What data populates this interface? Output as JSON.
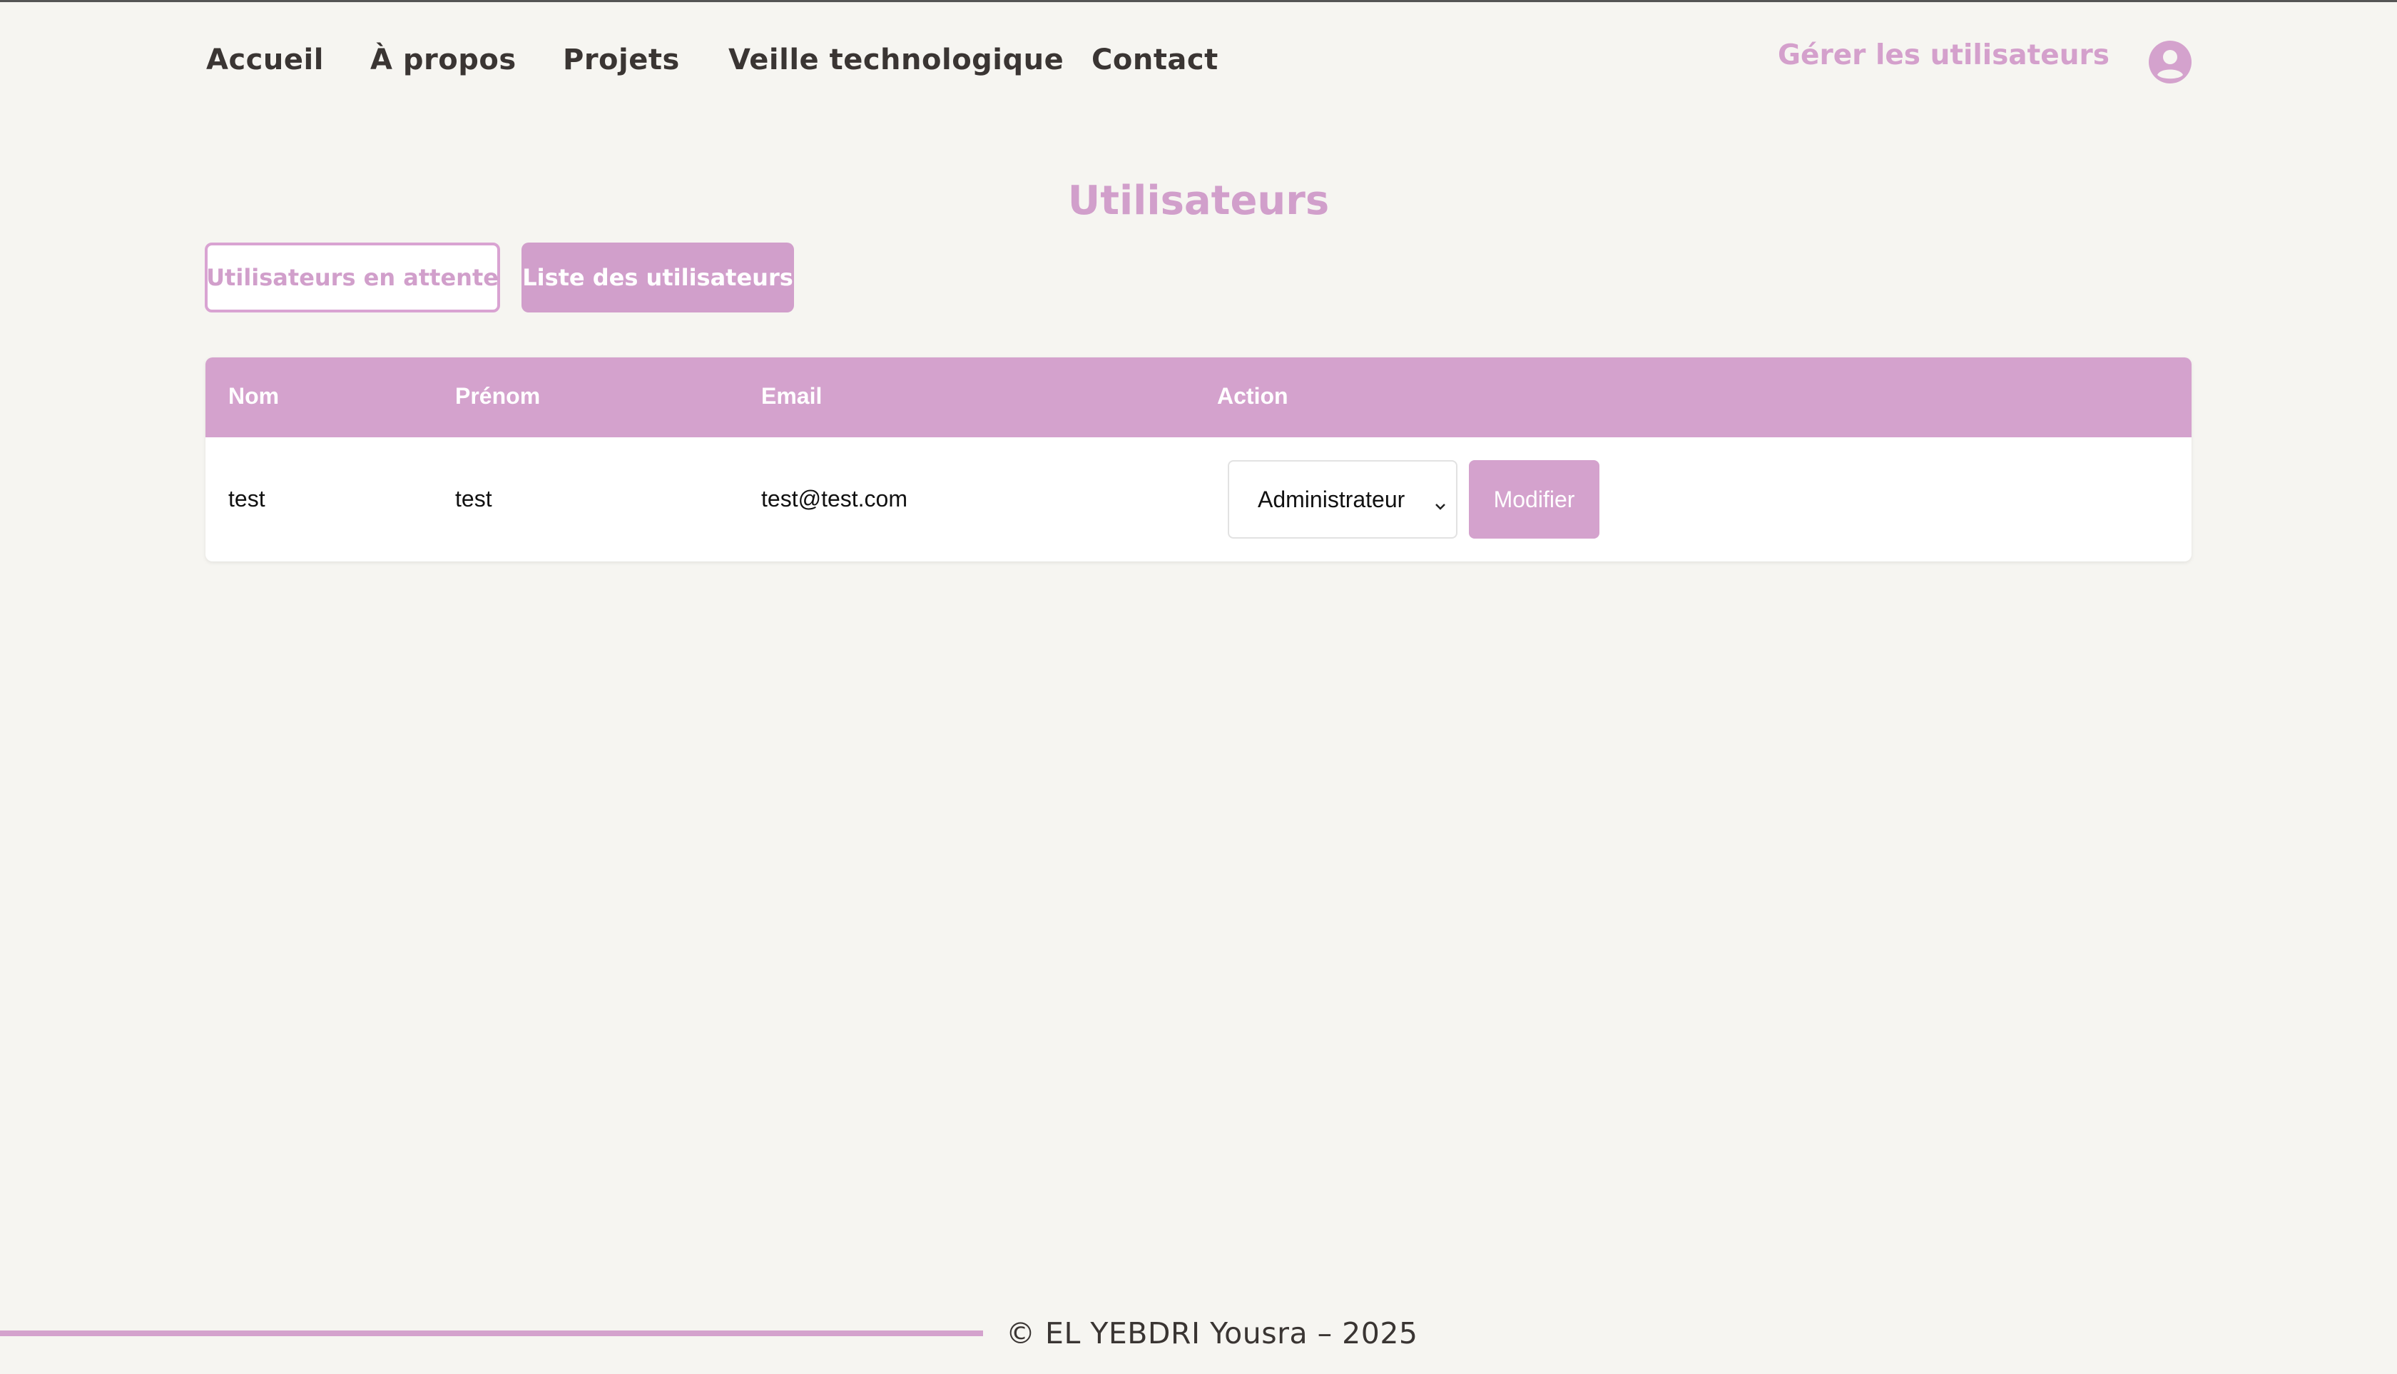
{
  "nav": {
    "items": [
      {
        "label": "Accueil"
      },
      {
        "label": "À propos"
      },
      {
        "label": "Projets"
      },
      {
        "label": "Veille technologique"
      },
      {
        "label": "Contact"
      }
    ],
    "admin_link": "Gérer les utilisateurs",
    "avatar_icon": "user-circle-icon"
  },
  "page": {
    "title": "Utilisateurs"
  },
  "tabs": {
    "pending": "Utilisateurs en attente",
    "list": "Liste des utilisateurs"
  },
  "table": {
    "headers": {
      "nom": "Nom",
      "prenom": "Prénom",
      "email": "Email",
      "action": "Action"
    },
    "rows": [
      {
        "nom": "test",
        "prenom": "test",
        "email": "test@test.com",
        "role": "Administrateur",
        "button": "Modifier"
      }
    ]
  },
  "footer": {
    "text": "© EL YEBDRI Yousra – 2025"
  },
  "colors": {
    "accent": "#d4a2cd",
    "background": "#f6f5f1",
    "text": "#3a3533"
  }
}
